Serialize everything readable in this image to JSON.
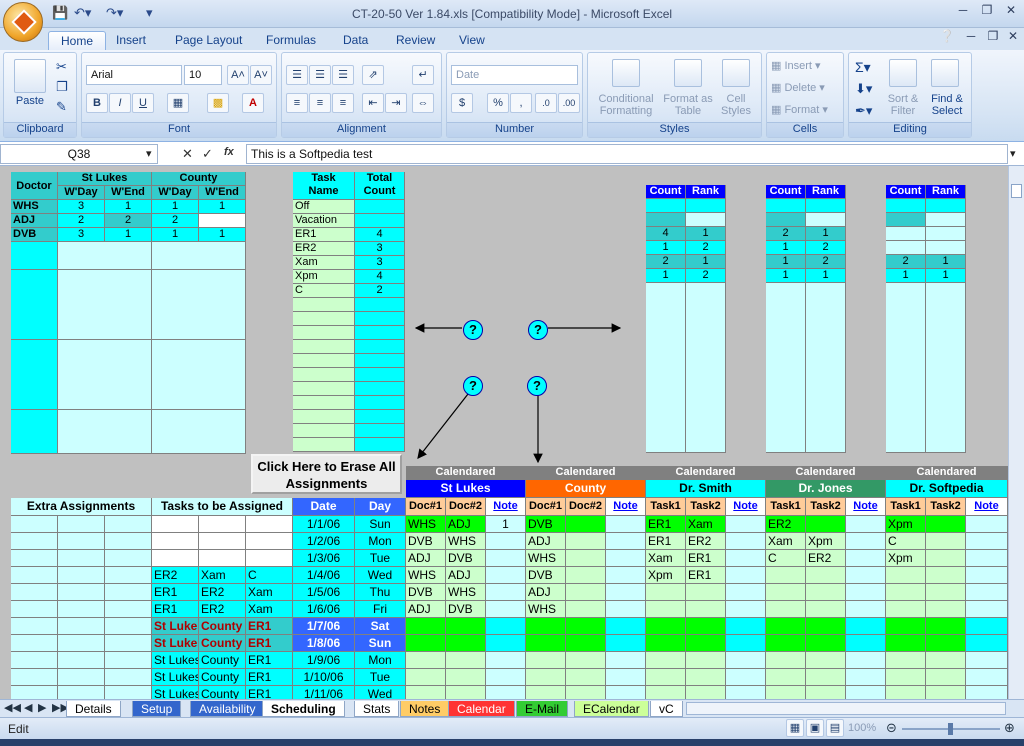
{
  "window": {
    "title": "CT-20-50 Ver 1.84.xls  [Compatibility Mode] - Microsoft Excel"
  },
  "ribbon_tabs": [
    "Home",
    "Insert",
    "Page Layout",
    "Formulas",
    "Data",
    "Review",
    "View"
  ],
  "ribbon": {
    "paste": "Paste",
    "font_name": "Arial",
    "font_size": "10",
    "number_format": "Date",
    "groups": {
      "clipboard": "Clipboard",
      "font": "Font",
      "alignment": "Alignment",
      "number": "Number",
      "styles": "Styles",
      "cells": "Cells",
      "editing": "Editing"
    },
    "conditional": "Conditional Formatting",
    "format_table": "Format as Table",
    "cell_styles": "Cell Styles",
    "insert": "Insert",
    "delete": "Delete",
    "format": "Format",
    "sort_filter": "Sort & Filter",
    "find_select": "Find & Select"
  },
  "formula_bar": {
    "name_box": "Q38",
    "fx": "fx",
    "content": "This is a Softpedia test"
  },
  "summary": {
    "doctor_label": "Doctor",
    "st_lukes": "St Lukes",
    "county": "County",
    "wday": "W'Day",
    "wend": "W'End",
    "rows": [
      {
        "name": "WHS",
        "v": [
          "3",
          "1",
          "1",
          "1"
        ]
      },
      {
        "name": "ADJ",
        "v": [
          "2",
          "2",
          "2",
          ""
        ]
      },
      {
        "name": "DVB",
        "v": [
          "3",
          "1",
          "1",
          "1"
        ]
      }
    ]
  },
  "tasks": {
    "header_task": "Task Name",
    "header_count": "Total Count",
    "rows": [
      [
        "Off",
        ""
      ],
      [
        "Vacation",
        ""
      ],
      [
        "ER1",
        "4"
      ],
      [
        "ER2",
        "3"
      ],
      [
        "Xam",
        "3"
      ],
      [
        "Xpm",
        "4"
      ],
      [
        "C",
        "2"
      ]
    ]
  },
  "count_rank": {
    "count": "Count",
    "rank": "Rank",
    "b1": [
      [
        "4",
        "1"
      ],
      [
        "1",
        "2"
      ],
      [
        "2",
        "1"
      ],
      [
        "1",
        "2"
      ]
    ],
    "b2": [
      [
        "2",
        "1"
      ],
      [
        "1",
        "2"
      ],
      [
        "1",
        "2"
      ],
      [
        "1",
        "1"
      ]
    ],
    "b3": [
      [
        "2",
        "1"
      ],
      [
        "1",
        "1"
      ]
    ]
  },
  "help_mark": "?",
  "erase_button": "Click Here to Erase All Assignments",
  "schedule_headers": {
    "extra": "Extra Assignments",
    "tasks_to_assign": "Tasks to be Assigned",
    "date": "Date",
    "day": "Day",
    "calendared": "Calendared",
    "groups": [
      "St Lukes",
      "County",
      "Dr. Smith",
      "Dr. Jones",
      "Dr. Softpedia"
    ],
    "doc1": "Doc#1",
    "doc2": "Doc#2",
    "note": "Note",
    "task1": "Task1",
    "task2": "Task2"
  },
  "schedule_rows": [
    {
      "t1": "",
      "t2": "",
      "t3": "",
      "date": "1/1/06",
      "day": "Sun",
      "sl1": "WHS",
      "sl2": "ADJ",
      "sln": "1",
      "c1": "DVB",
      "c2": "",
      "s1": "ER1",
      "s2": "Xam",
      "j1": "ER2",
      "j2": "",
      "p1": "Xpm",
      "p2": ""
    },
    {
      "t1": "",
      "t2": "",
      "t3": "",
      "date": "1/2/06",
      "day": "Mon",
      "sl1": "DVB",
      "sl2": "WHS",
      "sln": "",
      "c1": "ADJ",
      "c2": "",
      "s1": "ER1",
      "s2": "ER2",
      "j1": "Xam",
      "j2": "Xpm",
      "p1": "C",
      "p2": ""
    },
    {
      "t1": "",
      "t2": "",
      "t3": "",
      "date": "1/3/06",
      "day": "Tue",
      "sl1": "ADJ",
      "sl2": "DVB",
      "sln": "",
      "c1": "WHS",
      "c2": "",
      "s1": "Xam",
      "s2": "ER1",
      "j1": "C",
      "j2": "ER2",
      "p1": "Xpm",
      "p2": ""
    },
    {
      "t1": "ER2",
      "t2": "Xam",
      "t3": "C",
      "date": "1/4/06",
      "day": "Wed",
      "sl1": "WHS",
      "sl2": "ADJ",
      "sln": "",
      "c1": "DVB",
      "c2": "",
      "s1": "Xpm",
      "s2": "ER1",
      "j1": "",
      "j2": "",
      "p1": "",
      "p2": ""
    },
    {
      "t1": "ER1",
      "t2": "ER2",
      "t3": "Xam",
      "date": "1/5/06",
      "day": "Thu",
      "sl1": "DVB",
      "sl2": "WHS",
      "sln": "",
      "c1": "ADJ",
      "c2": "",
      "s1": "",
      "s2": "",
      "j1": "",
      "j2": "",
      "p1": "",
      "p2": ""
    },
    {
      "t1": "ER1",
      "t2": "ER2",
      "t3": "Xam",
      "date": "1/6/06",
      "day": "Fri",
      "sl1": "ADJ",
      "sl2": "DVB",
      "sln": "",
      "c1": "WHS",
      "c2": "",
      "s1": "",
      "s2": "",
      "j1": "",
      "j2": "",
      "p1": "",
      "p2": ""
    },
    {
      "t1": "St Lukes",
      "t2": "County",
      "t3": "ER1",
      "date": "1/7/06",
      "day": "Sat",
      "sl1": "",
      "sl2": "",
      "sln": "",
      "c1": "",
      "c2": "",
      "s1": "",
      "s2": "",
      "j1": "",
      "j2": "",
      "p1": "",
      "p2": ""
    },
    {
      "t1": "St Lukes",
      "t2": "County",
      "t3": "ER1",
      "date": "1/8/06",
      "day": "Sun",
      "sl1": "",
      "sl2": "",
      "sln": "",
      "c1": "",
      "c2": "",
      "s1": "",
      "s2": "",
      "j1": "",
      "j2": "",
      "p1": "",
      "p2": ""
    },
    {
      "t1": "St Lukes",
      "t2": "County",
      "t3": "ER1",
      "date": "1/9/06",
      "day": "Mon",
      "sl1": "",
      "sl2": "",
      "sln": "",
      "c1": "",
      "c2": "",
      "s1": "",
      "s2": "",
      "j1": "",
      "j2": "",
      "p1": "",
      "p2": ""
    },
    {
      "t1": "St Lukes",
      "t2": "County",
      "t3": "ER1",
      "date": "1/10/06",
      "day": "Tue",
      "sl1": "",
      "sl2": "",
      "sln": "",
      "c1": "",
      "c2": "",
      "s1": "",
      "s2": "",
      "j1": "",
      "j2": "",
      "p1": "",
      "p2": ""
    },
    {
      "t1": "St Lukes",
      "t2": "County",
      "t3": "ER1",
      "date": "1/11/06",
      "day": "Wed",
      "sl1": "",
      "sl2": "",
      "sln": "",
      "c1": "",
      "c2": "",
      "s1": "",
      "s2": "",
      "j1": "",
      "j2": "",
      "p1": "",
      "p2": ""
    }
  ],
  "sheet_tabs": [
    "Details",
    "Setup",
    "Availability",
    "Scheduling",
    "Stats",
    "Notes",
    "Calendar",
    "E-Mail",
    "ECalendar",
    "vC"
  ],
  "active_sheet": "Scheduling",
  "status": {
    "mode": "Edit",
    "zoom": "100%"
  },
  "colors": {
    "cyan": "#00ffff",
    "light_cyan": "#ccffff",
    "teal": "#33cccc",
    "light_green": "#ccffcc",
    "green": "#00ff00",
    "blue": "#0000ff",
    "orange": "#ff6600",
    "dark_blue_header": "#3366ff"
  }
}
